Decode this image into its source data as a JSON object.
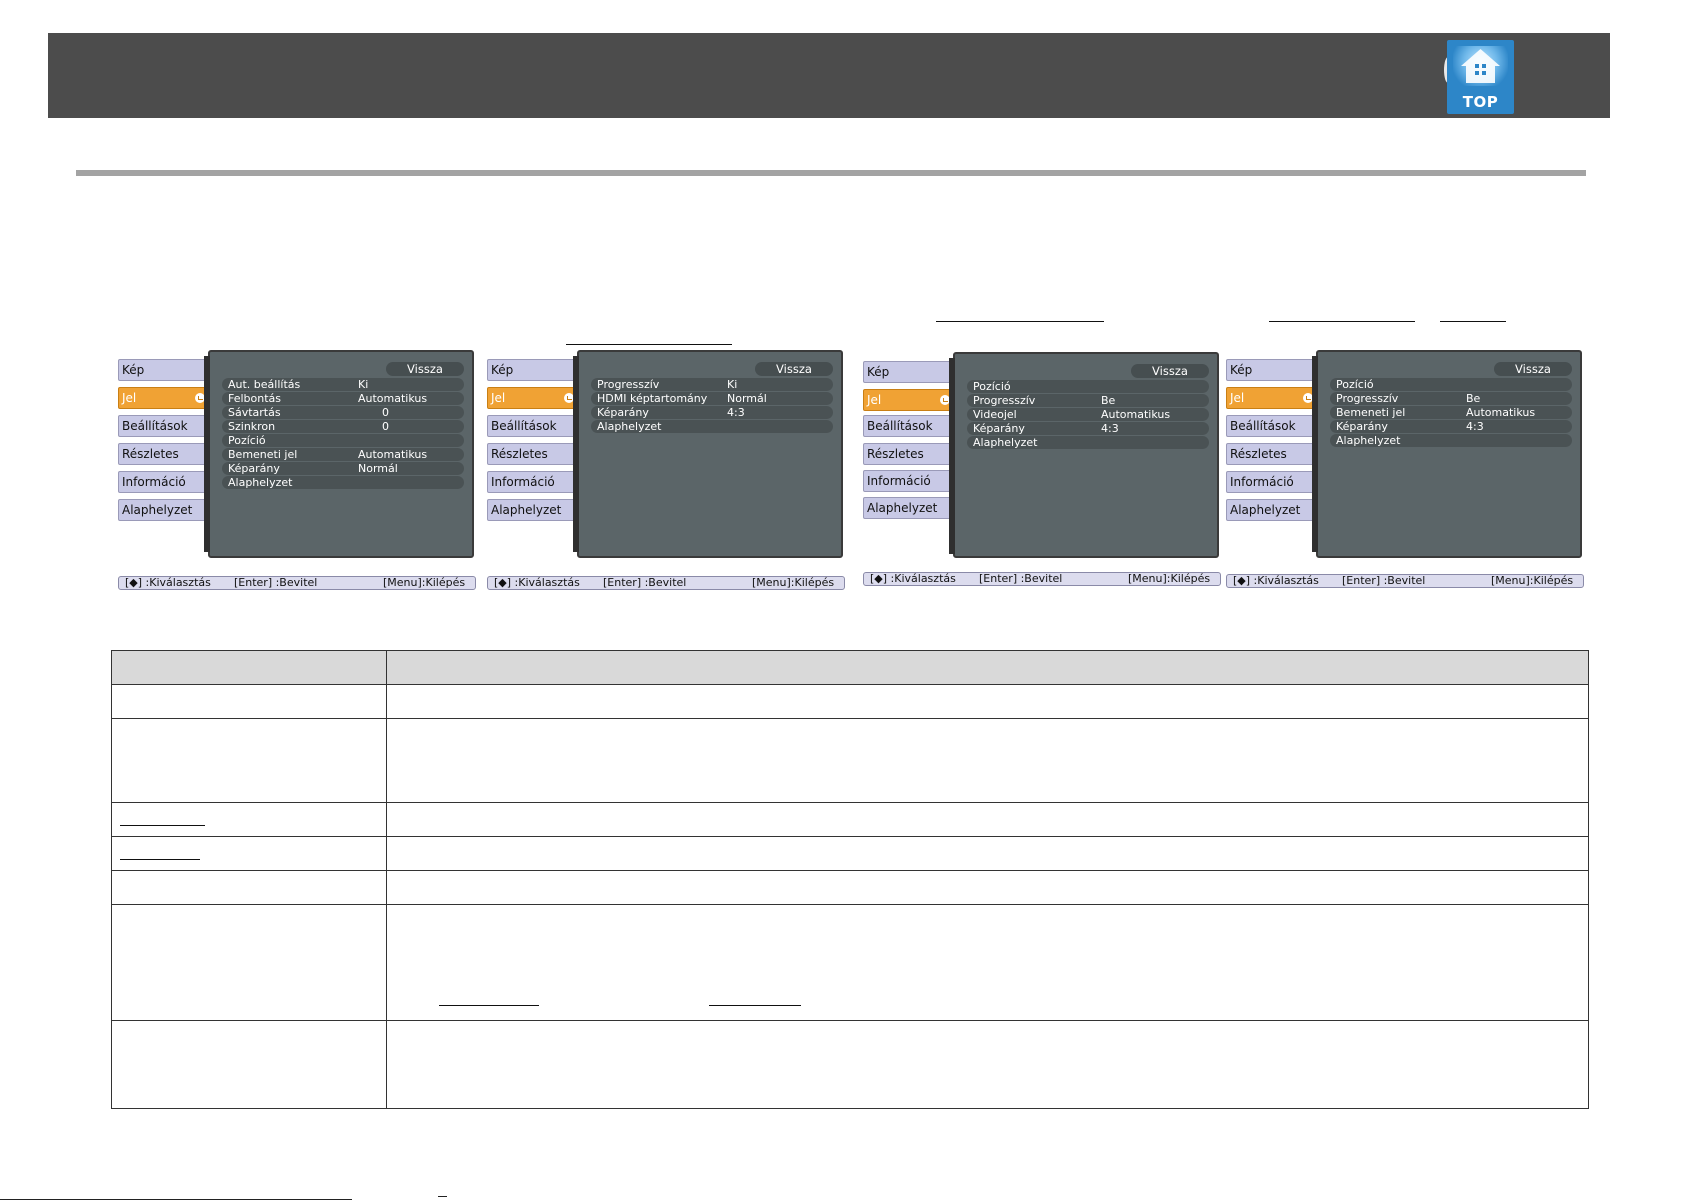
{
  "header": {
    "logo_text": "TOP",
    "logo_icon": "house-top-icon"
  },
  "menus": [
    {
      "tabs": [
        "Kép",
        "Jel",
        "Beállítások",
        "Részletes",
        "Információ",
        "Alaphelyzet"
      ],
      "active_tab": "Jel",
      "back_label": "Vissza",
      "rows": [
        {
          "label": "Aut. beállítás",
          "value": "Ki"
        },
        {
          "label": "Felbontás",
          "value": "Automatikus"
        },
        {
          "label": "Sávtartás",
          "value": "0"
        },
        {
          "label": "Szinkron",
          "value": "0"
        },
        {
          "label": "Pozíció",
          "value": ""
        },
        {
          "label": "Bemeneti jel",
          "value": "Automatikus"
        },
        {
          "label": "Képarány",
          "value": "Normál"
        },
        {
          "label": "Alaphelyzet",
          "value": ""
        }
      ],
      "footer": {
        "select": "[◆] :Kiválasztás",
        "enter": "[Enter] :Bevitel",
        "exit": "[Menu]:Kilépés"
      }
    },
    {
      "tabs": [
        "Kép",
        "Jel",
        "Beállítások",
        "Részletes",
        "Információ",
        "Alaphelyzet"
      ],
      "active_tab": "Jel",
      "back_label": "Vissza",
      "rows": [
        {
          "label": "Progresszív",
          "value": "Ki"
        },
        {
          "label": "HDMI képtartomány",
          "value": "Normál"
        },
        {
          "label": "Képarány",
          "value": "4:3"
        },
        {
          "label": "Alaphelyzet",
          "value": ""
        }
      ],
      "footer": {
        "select": "[◆] :Kiválasztás",
        "enter": "[Enter] :Bevitel",
        "exit": "[Menu]:Kilépés"
      }
    },
    {
      "tabs": [
        "Kép",
        "Jel",
        "Beállítások",
        "Részletes",
        "Információ",
        "Alaphelyzet"
      ],
      "active_tab": "Jel",
      "back_label": "Vissza",
      "rows": [
        {
          "label": "Pozíció",
          "value": ""
        },
        {
          "label": "Progresszív",
          "value": "Be"
        },
        {
          "label": "Videojel",
          "value": "Automatikus"
        },
        {
          "label": "Képarány",
          "value": "4:3"
        },
        {
          "label": "Alaphelyzet",
          "value": ""
        }
      ],
      "footer": {
        "select": "[◆] :Kiválasztás",
        "enter": "[Enter] :Bevitel",
        "exit": "[Menu]:Kilépés"
      }
    },
    {
      "tabs": [
        "Kép",
        "Jel",
        "Beállítások",
        "Részletes",
        "Információ",
        "Alaphelyzet"
      ],
      "active_tab": "Jel",
      "back_label": "Vissza",
      "rows": [
        {
          "label": "Pozíció",
          "value": ""
        },
        {
          "label": "Progresszív",
          "value": "Be"
        },
        {
          "label": "Bemeneti jel",
          "value": "Automatikus"
        },
        {
          "label": "Képarány",
          "value": "4:3"
        },
        {
          "label": "Alaphelyzet",
          "value": ""
        }
      ],
      "footer": {
        "select": "[◆] :Kiválasztás",
        "enter": "[Enter] :Bevitel",
        "exit": "[Menu]:Kilépés"
      }
    }
  ]
}
